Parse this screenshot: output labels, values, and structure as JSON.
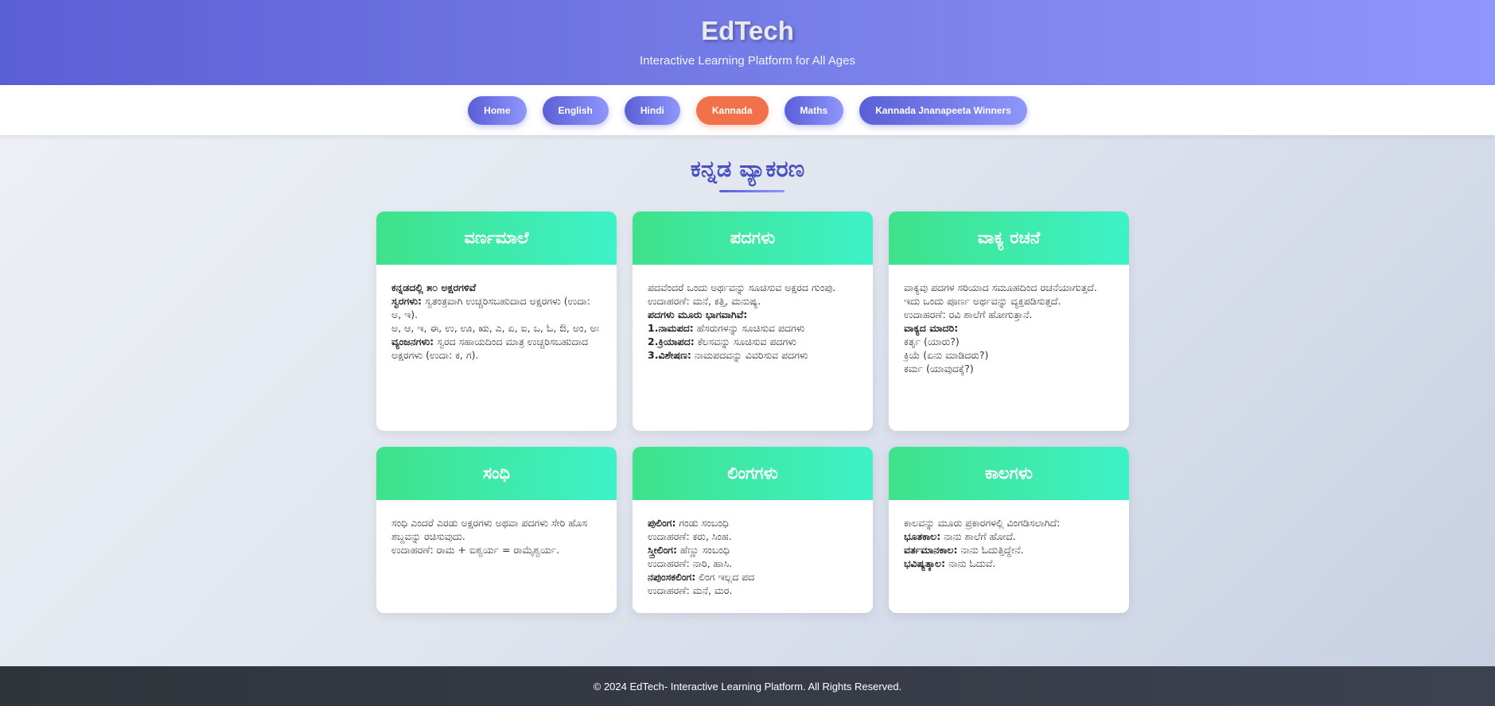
{
  "header": {
    "title": "EdTech",
    "subtitle": "Interactive Learning Platform for All Ages"
  },
  "nav": {
    "items": [
      {
        "label": "Home"
      },
      {
        "label": "English"
      },
      {
        "label": "Hindi"
      },
      {
        "label": "Kannada"
      },
      {
        "label": "Maths"
      },
      {
        "label": "Kannada Jnanapeeta Winners"
      }
    ],
    "active": "Kannada"
  },
  "main": {
    "title": "ಕನ್ನಡ ವ್ಯಾಕರಣ"
  },
  "cards": [
    {
      "title": "ವರ್ಣಮಾಲೆ",
      "lines": [
        {
          "bold": "ಕನ್ನಡದಲ್ಲಿ ೫೦ ಅಕ್ಷರಗಳಿವೆ",
          "text": ""
        },
        {
          "bold": "ಸ್ವರಗಳು:",
          "text": " ಸ್ವತಂತ್ರವಾಗಿ ಉಚ್ಚರಿಸಬಹುದಾದ ಅಕ್ಷರಗಳು (ಉದಾ: ಅ, ಇ)."
        },
        {
          "bold": "",
          "text": "ಅ, ಆ, ಇ, ಈ, ಉ, ಊ, ಋ, ಎ, ಏ, ಐ, ಒ, ಓ, ಔ, ಅಂ, ಅಃ"
        },
        {
          "bold": "ವ್ಯಂಜನಗಳು:",
          "text": " ಸ್ವರದ ಸಹಾಯದಿಂದ ಮಾತ್ರ ಉಚ್ಚರಿಸಬಹುದಾದ ಅಕ್ಷರಗಳು (ಉದಾ: ಕ, ಗ)."
        }
      ]
    },
    {
      "title": "ಪದಗಳು",
      "lines": [
        {
          "bold": "",
          "text": "ಪದವೆಂದರೆ ಒಂದು ಅರ್ಥವನ್ನು ಸೂಚಿಸುವ ಅಕ್ಷರದ ಗುಂಪು. ಉದಾಹರಣೆ: ಮನೆ, ಕತ್ತಿ, ಮನುಷ್ಯ."
        },
        {
          "bold": "ಪದಗಳು ಮೂರು ಭಾಗವಾಗಿವೆ:",
          "text": ""
        },
        {
          "bold": "1.ನಾಮಪದ:",
          "text": " ಹೆಸರುಗಳನ್ನು ಸೂಚಿಸುವ ಪದಗಳು"
        },
        {
          "bold": "2.ಕ್ರಿಯಾಪದ:",
          "text": " ಕೆಲಸವನ್ನು ಸೂಚಿಸುವ ಪದಗಳು"
        },
        {
          "bold": "3.ವಿಶೇಷಣ:",
          "text": " ನಾಮಪದವನ್ನು ವಿವರಿಸುವ ಪದಗಳು"
        }
      ]
    },
    {
      "title": "ವಾಕ್ಯ ರಚನೆ",
      "lines": [
        {
          "bold": "",
          "text": "ವಾಕ್ಯವು ಪದಗಳ ಸರಿಯಾದ ಸಮೂಹದಿಂದ ರಚನೆಯಾಗುತ್ತದೆ. ಇದು ಒಂದು ಪೂರ್ಣ ಅರ್ಥವನ್ನು ವ್ಯಕ್ತಪಡಿಸುತ್ತದೆ."
        },
        {
          "bold": "",
          "text": "ಉದಾಹರಣೆ: ರವಿ ಶಾಲೆಗೆ ಹೋಗುತ್ತಾನೆ."
        },
        {
          "bold": "ವಾಕ್ಯದ ಮಾದರಿ:",
          "text": ""
        },
        {
          "bold": "",
          "text": "ಕರ್ತೃ (ಯಾರು?)"
        },
        {
          "bold": "",
          "text": "ಕ್ರಿಯೆ (ಏನು ಮಾಡಿದರು?)"
        },
        {
          "bold": "",
          "text": "ಕರ್ಮ (ಯಾವುದಕ್ಕೆ?)"
        }
      ]
    },
    {
      "title": "ಸಂಧಿ",
      "lines": [
        {
          "bold": "",
          "text": "ಸಂಧಿ ಎಂದರೆ ಎರಡು ಅಕ್ಷರಗಳು ಅಥವಾ ಪದಗಳು ಸೇರಿ ಹೊಸ ಶಬ್ದವನ್ನು ರಚಿಸುವುದು."
        },
        {
          "bold": "",
          "text": "ಉದಾಹರಣೆ: ರಾಮ + ಐಶ್ವರ್ಯ = ರಾಮೈಶ್ವರ್ಯ."
        }
      ]
    },
    {
      "title": "ಲಿಂಗಗಳು",
      "lines": [
        {
          "bold": "ಪುಲಿಂಗ:",
          "text": " ಗಂಡು ಸಂಬಂಧಿ"
        },
        {
          "bold": "",
          "text": "ಉದಾಹರಣೆ: ಕರು, ಸಿಂಹ."
        },
        {
          "bold": "ಸ್ತ್ರೀಲಿಂಗ:",
          "text": " ಹೆಣ್ಣು ಸಂಬಂಧಿ"
        },
        {
          "bold": "",
          "text": "ಉದಾಹರಣೆ: ನಾರಿ, ಹಾಸಿ."
        },
        {
          "bold": "ನಪುಂಸಕಲಿಂಗ:",
          "text": " ಲಿಂಗ ಇಲ್ಲದ ಪದ"
        },
        {
          "bold": "",
          "text": "ಉದಾಹರಣೆ: ಮನೆ, ಮರ."
        }
      ]
    },
    {
      "title": "ಕಾಲಗಳು",
      "lines": [
        {
          "bold": "",
          "text": "ಕಾಲವನ್ನು ಮೂರು ಪ್ರಕಾರಗಳಲ್ಲಿ ವಿಂಗಡಿಸಲಾಗಿದೆ:"
        },
        {
          "bold": "ಭೂತಕಾಲ:",
          "text": " ನಾನು ಶಾಲೆಗೆ ಹೋದೆ."
        },
        {
          "bold": "ವರ್ತಮಾನಕಾಲ:",
          "text": " ನಾನು ಓದುತ್ತಿದ್ದೇನೆ."
        },
        {
          "bold": "ಭವಿಷ್ಯತ್ಕಾಲ:",
          "text": " ನಾನು ಓದುವೆ."
        }
      ]
    }
  ],
  "footer": {
    "text": "© 2024 EdTech- Interactive Learning Platform. All Rights Reserved."
  },
  "colors": {
    "header_gradient_start": "#5a5fd6",
    "header_gradient_end": "#8f96fb",
    "active_nav": "#f0714a",
    "card_head_start": "#3fe28a",
    "card_head_end": "#3ef2c8",
    "footer": "#2f333a"
  }
}
